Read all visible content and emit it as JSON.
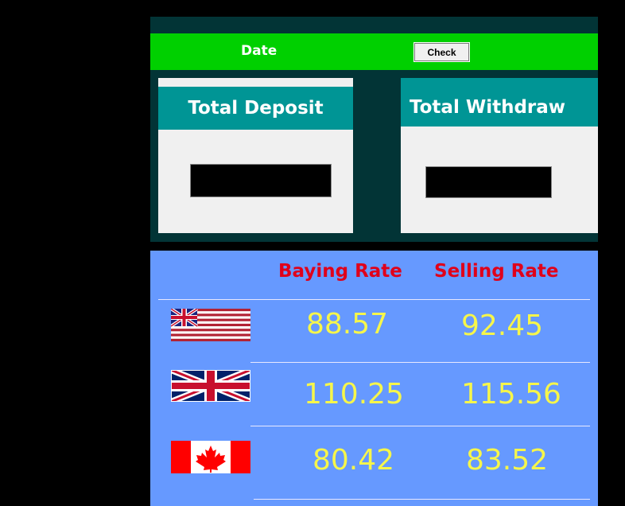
{
  "header": {
    "date_label": "Date",
    "check_label": "Check"
  },
  "cards": {
    "deposit_title": "Total Deposit",
    "withdraw_title": "Total Withdraw"
  },
  "rates": {
    "buying_header": "Baying Rate",
    "selling_header": "Selling Rate",
    "rows": [
      {
        "flag": "us-flag-icon",
        "buy": "88.57",
        "sell": "92.45"
      },
      {
        "flag": "uk-flag-icon",
        "buy": "110.25",
        "sell": "115.56"
      },
      {
        "flag": "canada-flag-icon",
        "buy": "80.42",
        "sell": "83.52"
      }
    ]
  },
  "colors": {
    "panel_dark": "#023436",
    "date_bar": "#00d000",
    "card_header": "#009595",
    "rates_bg": "#6699ff",
    "header_text": "#e0001a",
    "rate_text": "#f6f64a"
  }
}
